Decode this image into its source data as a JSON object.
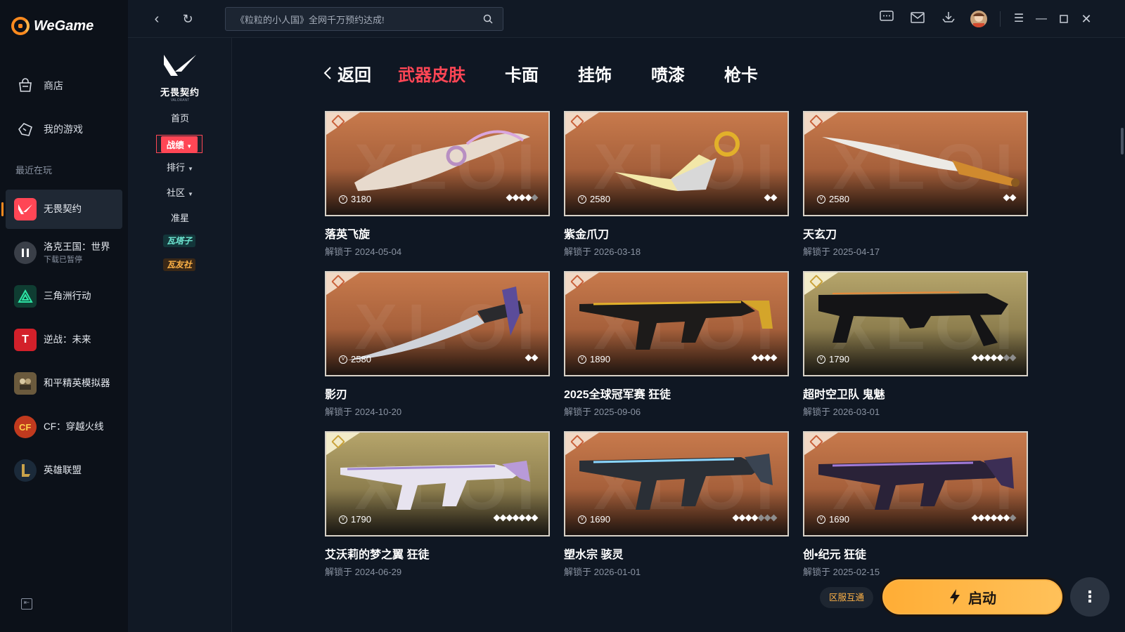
{
  "app": {
    "name": "WeGame"
  },
  "nav": {
    "store": "商店",
    "my_games": "我的游戏",
    "recent_heading": "最近在玩"
  },
  "recent_games": [
    {
      "name": "无畏契约",
      "sub": "",
      "icon": "valorant-icon",
      "color": "#ff4655"
    },
    {
      "name": "洛克王国：世界",
      "sub": "下载已暂停",
      "icon": "pause-icon",
      "color": "#3a3f48"
    },
    {
      "name": "三角洲行动",
      "sub": "",
      "icon": "delta-force-icon",
      "color": "#0f3d32"
    },
    {
      "name": "逆战：未来",
      "sub": "",
      "icon": "nizhan-icon",
      "color": "#d3202a"
    },
    {
      "name": "和平精英模拟器",
      "sub": "",
      "icon": "peace-elite-icon",
      "color": "#6b5a3d"
    },
    {
      "name": "CF：穿越火线",
      "sub": "",
      "icon": "crossfire-icon",
      "color": "#c13a1e"
    },
    {
      "name": "英雄联盟",
      "sub": "",
      "icon": "league-icon",
      "color": "#1b2a3a"
    }
  ],
  "topbar": {
    "search_text": "《粒粒的小人国》全网千万预约达成!"
  },
  "game_sidebar": {
    "title": "无畏契约",
    "subtitle": "VALORANT",
    "home": "首页",
    "record": "战绩",
    "ranking": "排行",
    "community": "社区",
    "crosshair": "准星",
    "badge1": "瓦塔子",
    "badge2": "瓦友社"
  },
  "tabs": {
    "back": "返回",
    "items": [
      "武器皮肤",
      "卡面",
      "挂饰",
      "喷漆",
      "枪卡"
    ],
    "active": 0
  },
  "skins": [
    {
      "name": "落英飞旋",
      "date": "解锁于 2024-05-04",
      "price": "3180",
      "pips_on": 4,
      "pips_total": 5,
      "bg": "orange",
      "weapon": "knife-curved"
    },
    {
      "name": "紫金爪刀",
      "date": "解锁于 2026-03-18",
      "price": "2580",
      "pips_on": 2,
      "pips_total": 2,
      "bg": "orange",
      "weapon": "karambit"
    },
    {
      "name": "天玄刀",
      "date": "解锁于 2025-04-17",
      "price": "2580",
      "pips_on": 2,
      "pips_total": 2,
      "bg": "orange",
      "weapon": "blade"
    },
    {
      "name": "影刃",
      "date": "解锁于 2024-10-20",
      "price": "2580",
      "pips_on": 2,
      "pips_total": 2,
      "bg": "orange",
      "weapon": "dagger"
    },
    {
      "name": "2025全球冠军赛 狂徒",
      "date": "解锁于 2025-09-06",
      "price": "1890",
      "pips_on": 4,
      "pips_total": 4,
      "bg": "orange",
      "weapon": "rifle"
    },
    {
      "name": "超时空卫队 鬼魅",
      "date": "解锁于 2026-03-01",
      "price": "1790",
      "pips_on": 5,
      "pips_total": 7,
      "bg": "gold",
      "weapon": "pistol"
    },
    {
      "name": "艾沃莉的梦之翼 狂徒",
      "date": "解锁于 2024-06-29",
      "price": "1790",
      "pips_on": 7,
      "pips_total": 7,
      "bg": "gold",
      "weapon": "rifle-white"
    },
    {
      "name": "塑水宗 骇灵",
      "date": "解锁于 2026-01-01",
      "price": "1690",
      "pips_on": 4,
      "pips_total": 7,
      "bg": "orange",
      "weapon": "rifle-blue"
    },
    {
      "name": "创•纪元 狂徒",
      "date": "解锁于 2025-02-15",
      "price": "1690",
      "pips_on": 6,
      "pips_total": 7,
      "bg": "orange",
      "weapon": "rifle-purple"
    }
  ],
  "footer": {
    "region": "区服互通",
    "launch": "启动"
  },
  "colors": {
    "accent": "#ff4655",
    "brand": "#ff8a1e",
    "launch": "#ffb347"
  }
}
